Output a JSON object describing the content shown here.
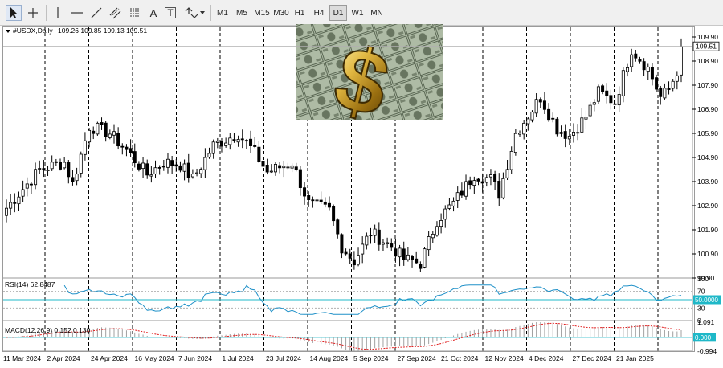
{
  "toolbar": {
    "tools": [
      {
        "id": "cursor",
        "icon": "cursor-arrow-icon"
      },
      {
        "id": "crosshair",
        "icon": "crosshair-icon"
      },
      {
        "id": "vline",
        "icon": "vertical-line-icon"
      },
      {
        "id": "hline",
        "icon": "horizontal-line-icon"
      },
      {
        "id": "trendline",
        "icon": "trendline-icon"
      },
      {
        "id": "channel",
        "icon": "equidistant-channel-icon"
      },
      {
        "id": "fibo",
        "icon": "fibonacci-icon"
      },
      {
        "id": "text",
        "icon": "text-icon",
        "label": "A"
      },
      {
        "id": "textlabel",
        "icon": "text-label-icon",
        "label": "T"
      },
      {
        "id": "arrows",
        "icon": "arrows-dropdown-icon"
      }
    ],
    "timeframes": [
      "M1",
      "M5",
      "M15",
      "M30",
      "H1",
      "H4",
      "D1",
      "W1",
      "MN"
    ],
    "active_timeframe": "D1"
  },
  "chart_data": [
    {
      "type": "candlestick",
      "title": "#USDX,Daily",
      "ohlc_header": "109.26 109.85 109.13 109.51",
      "current_price": 109.51,
      "ylim": [
        99.9,
        110.3
      ],
      "y_ticks": [
        "109.90",
        "108.90",
        "107.90",
        "106.90",
        "105.90",
        "104.90",
        "103.90",
        "102.90",
        "101.90",
        "100.90",
        "99.90"
      ],
      "x_ticks": [
        "11 Mar 2024",
        "2 Apr 2024",
        "24 Apr 2024",
        "16 May 2024",
        "7 Jun 2024",
        "1 Jul 2024",
        "23 Jul 2024",
        "14 Aug 2024",
        "5 Sep 2024",
        "27 Sep 2024",
        "21 Oct 2024",
        "12 Nov 2024",
        "4 Dec 2024",
        "27 Dec 2024",
        "21 Jan 2025"
      ],
      "bull_color": "#ffffff",
      "bear_color": "#000000",
      "grid": "vertical dashed",
      "close_anchors": [
        [
          0,
          102.8
        ],
        [
          8,
          104.4
        ],
        [
          14,
          104.7
        ],
        [
          16,
          103.8
        ],
        [
          20,
          106.2
        ],
        [
          25,
          105.9
        ],
        [
          29,
          105.2
        ],
        [
          34,
          104.2
        ],
        [
          38,
          104.7
        ],
        [
          42,
          104.6
        ],
        [
          45,
          104.0
        ],
        [
          50,
          105.4
        ],
        [
          56,
          105.9
        ],
        [
          60,
          105.1
        ],
        [
          63,
          104.3
        ],
        [
          69,
          104.7
        ],
        [
          73,
          103.0
        ],
        [
          78,
          102.7
        ],
        [
          81,
          101.2
        ],
        [
          84,
          100.6
        ],
        [
          88,
          101.8
        ],
        [
          93,
          101.2
        ],
        [
          96,
          100.7
        ],
        [
          100,
          100.5
        ],
        [
          104,
          102.3
        ],
        [
          108,
          103.0
        ],
        [
          113,
          104.2
        ],
        [
          117,
          104.0
        ],
        [
          119,
          103.4
        ],
        [
          123,
          105.9
        ],
        [
          127,
          106.9
        ],
        [
          129,
          107.4
        ],
        [
          133,
          106.1
        ],
        [
          136,
          105.8
        ],
        [
          140,
          106.6
        ],
        [
          143,
          107.6
        ],
        [
          147,
          107.2
        ],
        [
          151,
          109.4
        ],
        [
          155,
          108.6
        ],
        [
          158,
          107.4
        ],
        [
          160,
          107.7
        ],
        [
          162,
          108.5
        ],
        [
          163,
          109.51
        ]
      ]
    },
    {
      "type": "line",
      "title": "RSI(14) 62.8487",
      "ylim": [
        0,
        100
      ],
      "y_ticks": [
        "100",
        "70",
        "50.0000",
        "30",
        "0"
      ],
      "levels": [
        70,
        30
      ],
      "current_value": 50.0,
      "line_color": "#1e90c8"
    },
    {
      "type": "bar",
      "title": "MACD(12,26,9) 0.152 0.130",
      "y_ticks": [
        "1.091",
        "0.000",
        "-0.994"
      ],
      "ylim": [
        -0.994,
        1.091
      ],
      "current_value": 0.0,
      "histogram_color": "#a0a0a0",
      "signal_color": "#e02020"
    }
  ],
  "overlay": {
    "image_icon": "gold-dollar-sign-on-banknotes-image",
    "dollar_glyph": "$"
  }
}
